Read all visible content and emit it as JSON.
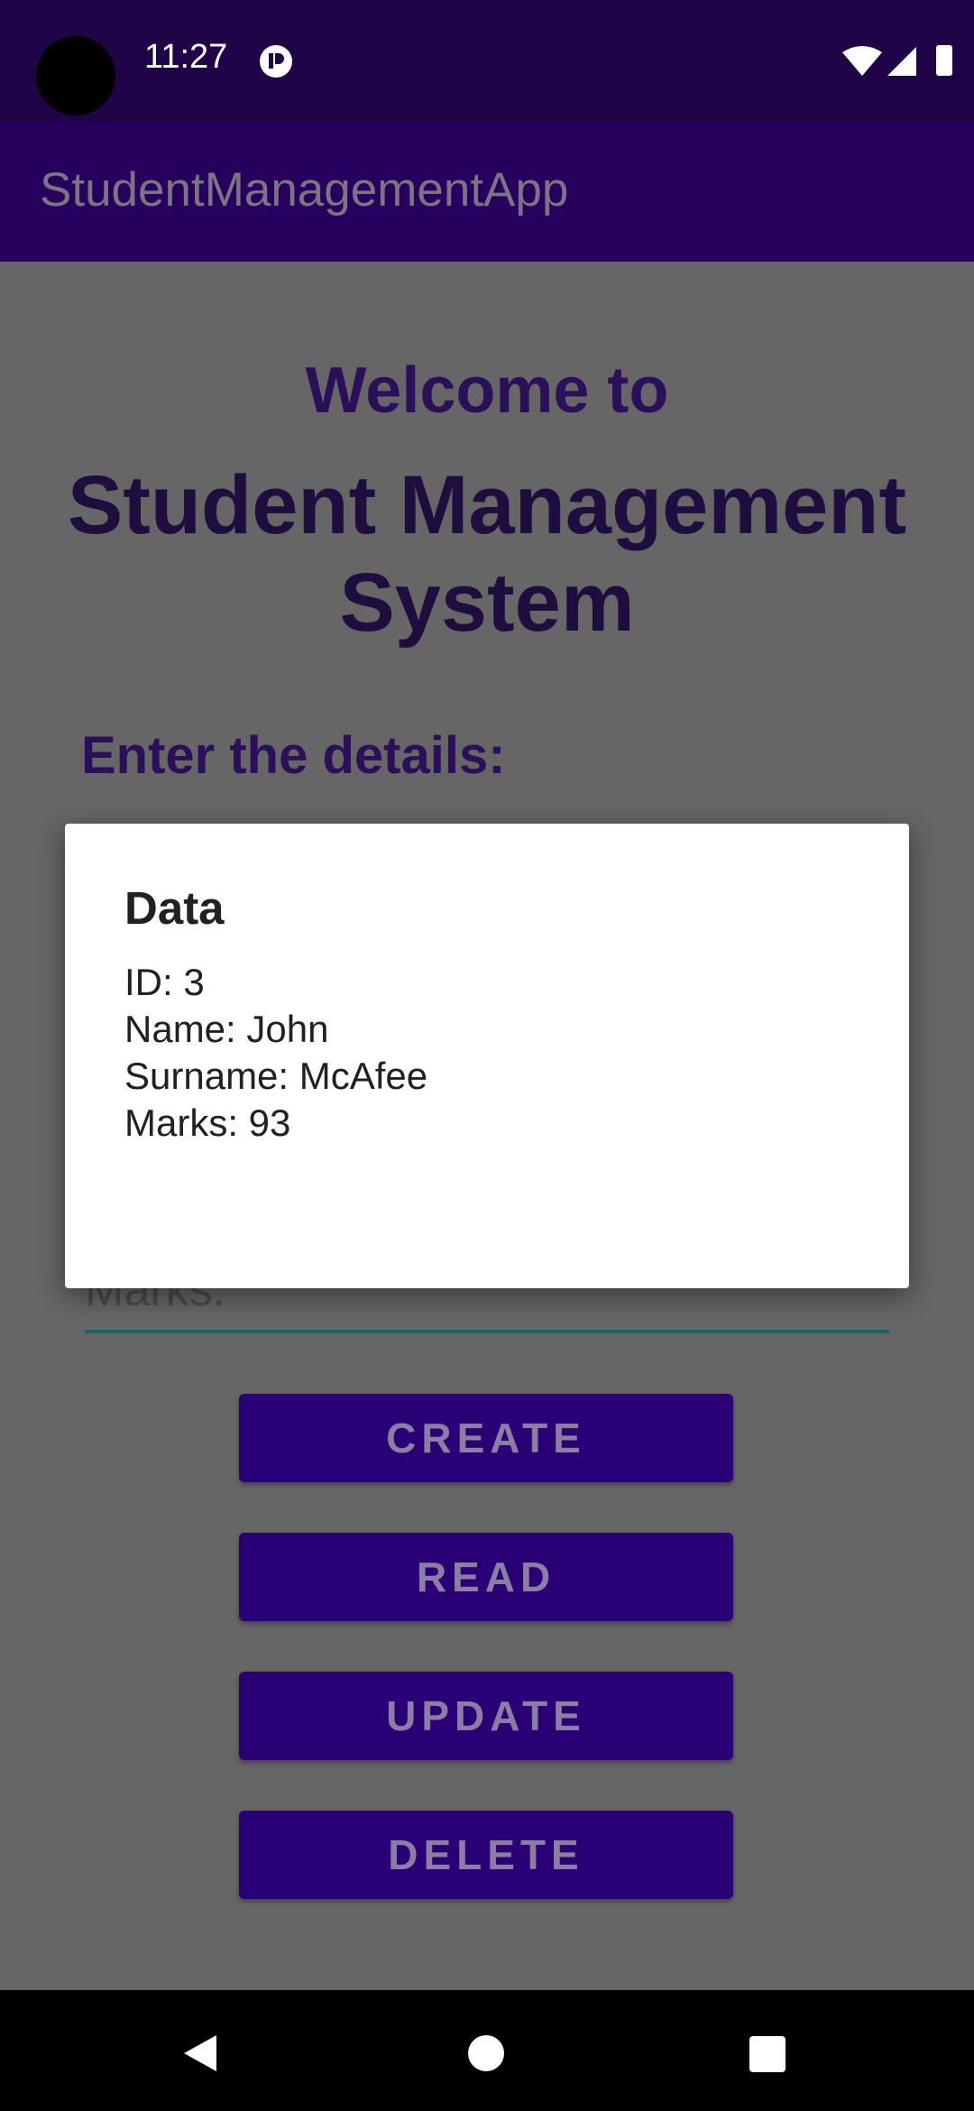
{
  "status_bar": {
    "time": "11:27",
    "icons": [
      "camera-cutout",
      "notification-app-icon",
      "wifi-icon",
      "cellular-signal-icon",
      "battery-icon"
    ]
  },
  "app_bar": {
    "title": "StudentManagementApp"
  },
  "main": {
    "welcome_line": "Welcome to",
    "system_title_line1": "Student Management",
    "system_title_line2": "System",
    "enter_details_label": "Enter the details:",
    "marks_hint": "Marks:",
    "buttons": {
      "create": "CREATE",
      "read": "READ",
      "update": "UPDATE",
      "delete": "DELETE"
    }
  },
  "dialog": {
    "title": "Data",
    "lines": [
      "ID: 3",
      "Name: John",
      "Surname: McAfee",
      "Marks: 93"
    ]
  },
  "nav_bar": {
    "icons": [
      "back-icon",
      "home-icon",
      "recents-icon"
    ]
  },
  "colors": {
    "status_bar": "#1f0548",
    "app_bar": "#27005e",
    "button": "#2a0077",
    "scrim_background": "#666666",
    "dialog": "#ffffff",
    "input_underline": "#17665f"
  }
}
